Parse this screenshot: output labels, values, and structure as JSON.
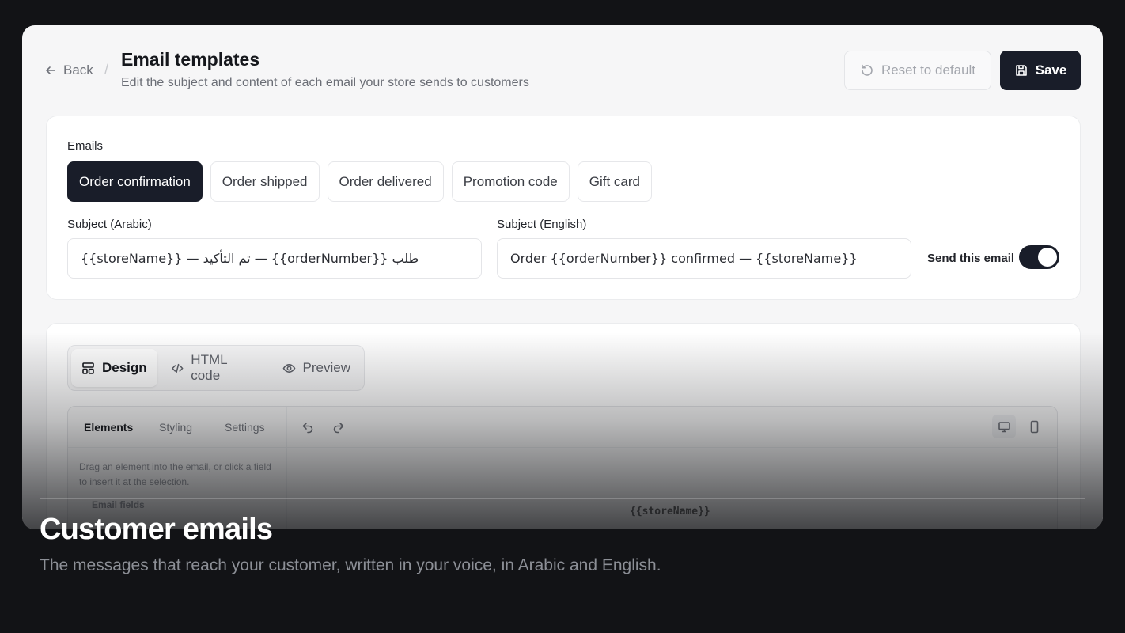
{
  "header": {
    "back_label": "Back",
    "separator": "/",
    "title": "Email templates",
    "subtitle": "Edit the subject and content of each email your store sends to customers",
    "reset_label": "Reset to default",
    "save_label": "Save"
  },
  "emails": {
    "label": "Emails",
    "tabs": [
      {
        "label": "Order confirmation",
        "active": true
      },
      {
        "label": "Order shipped"
      },
      {
        "label": "Order delivered"
      },
      {
        "label": "Promotion code"
      },
      {
        "label": "Gift card"
      }
    ]
  },
  "subject": {
    "arabic_label": "Subject (Arabic)",
    "arabic_value": "طلب {{orderNumber}} — تم التأكيد — {{storeName}}",
    "english_label": "Subject (English)",
    "english_value": "Order {{orderNumber}} confirmed — {{storeName}}",
    "send_label": "Send this email",
    "send_enabled": true
  },
  "editor": {
    "modes": [
      {
        "label": "Design",
        "icon": "layout-icon",
        "active": true
      },
      {
        "label": "HTML code",
        "icon": "code-icon"
      },
      {
        "label": "Preview",
        "icon": "eye-icon"
      }
    ],
    "builder_tabs": [
      "Elements",
      "Styling",
      "Settings"
    ],
    "hint": "Drag an element into the email, or click a field to insert it at the selection.",
    "fields_heading": "Email fields",
    "canvas_token": "{{storeName}}"
  },
  "caption": {
    "title": "Customer emails",
    "subtitle": "The messages that reach your customer, written in your voice, in Arabic and English."
  },
  "colors": {
    "background": "#121316",
    "card": "#f6f6f7",
    "primary": "#191d29",
    "muted_text": "#6b6e76"
  }
}
